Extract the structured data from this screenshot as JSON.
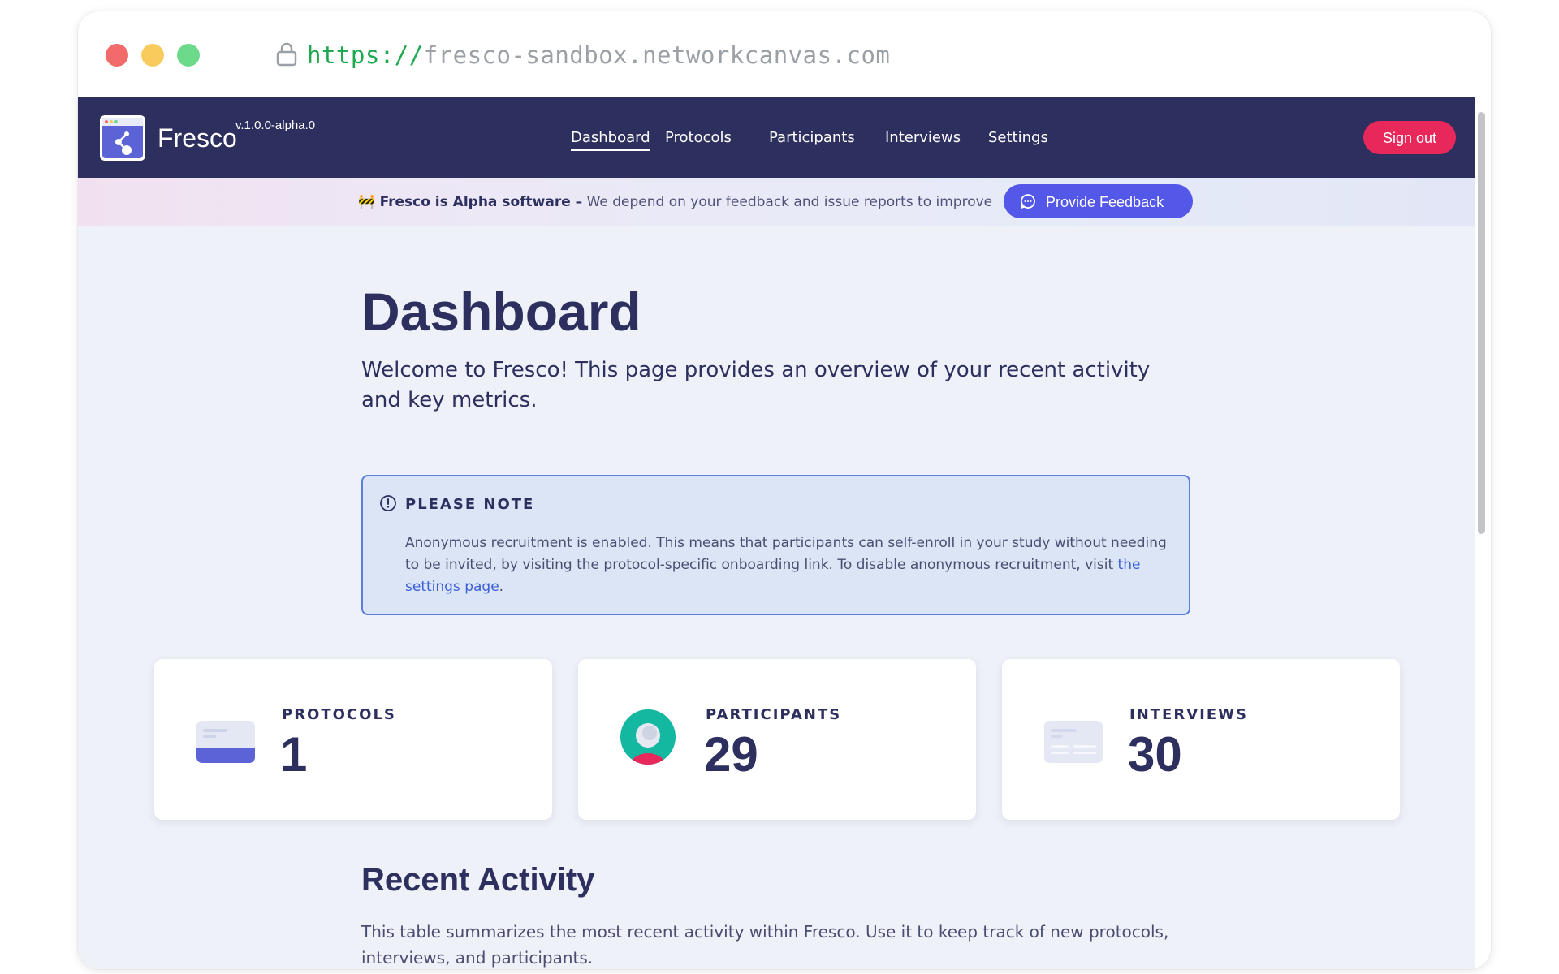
{
  "browser": {
    "url_scheme": "https://",
    "url_host": "fresco-sandbox.networkcanvas.com",
    "lock_icon": "lock-icon"
  },
  "nav": {
    "brand": "Fresco",
    "version": "v.1.0.0-alpha.0",
    "links": [
      "Dashboard",
      "Protocols",
      "Participants",
      "Interviews",
      "Settings"
    ],
    "active": "Dashboard",
    "sign_out": "Sign out"
  },
  "banner": {
    "emoji": "🚧",
    "bold_text": "Fresco is Alpha software –",
    "text": "We depend on your feedback and issue reports to improve",
    "button": "Provide Feedback"
  },
  "page": {
    "title": "Dashboard",
    "intro": "Welcome to Fresco! This page provides an overview of your recent activity and key metrics."
  },
  "note": {
    "title": "PLEASE NOTE",
    "body": "Anonymous recruitment is enabled. This means that participants can self-enroll in your study without needing to be invited, by visiting the protocol-specific onboarding link. To disable anonymous recruitment, visit ",
    "link": "the settings page",
    "after": "."
  },
  "stats": [
    {
      "label": "PROTOCOLS",
      "value": "1",
      "icon": "protocol-card-icon"
    },
    {
      "label": "PARTICIPANTS",
      "value": "29",
      "icon": "participant-avatar-icon"
    },
    {
      "label": "INTERVIEWS",
      "value": "30",
      "icon": "interview-card-icon"
    }
  ],
  "recent": {
    "title": "Recent Activity",
    "desc": "This table summarizes the most recent activity within Fresco. Use it to keep track of new protocols, interviews, and participants."
  },
  "colors": {
    "nav_bg": "#2d2f5e",
    "accent": "#5458e8",
    "sign_out": "#e8285a",
    "text": "#2d2f5e"
  }
}
